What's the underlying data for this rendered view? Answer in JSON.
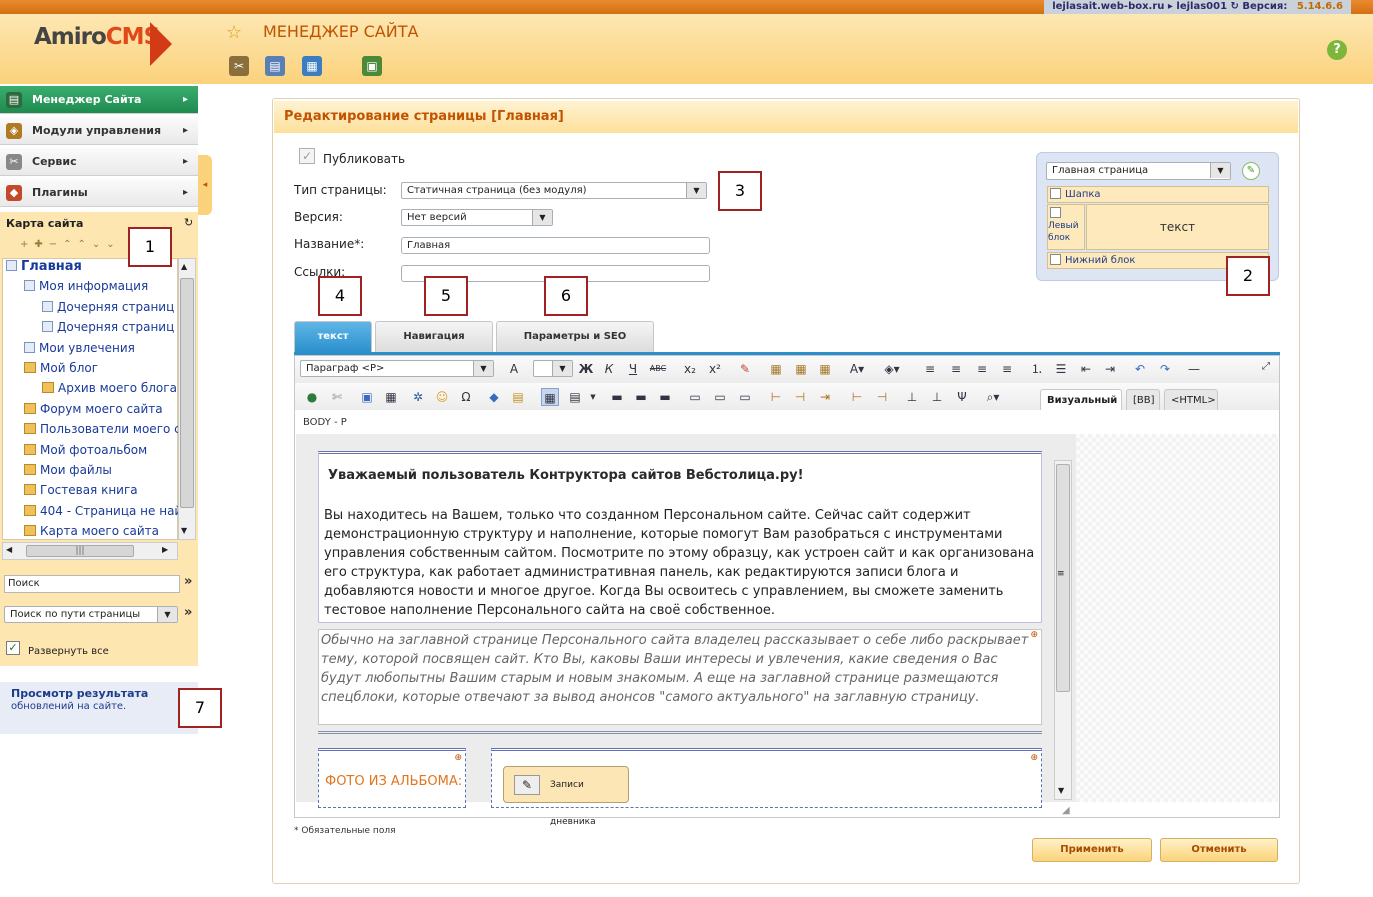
{
  "topbar": {
    "site": "lejlasait.web-box.ru",
    "sep": "▸",
    "user": "lejlas001",
    "version_label": "Версия:",
    "version": "5.14.6.6"
  },
  "header": {
    "logo_main": "Amiro",
    "logo_accent": "CMS",
    "title": "МЕНЕДЖЕР САЙТА",
    "help": "?"
  },
  "menu": [
    {
      "label": "Менеджер Сайта",
      "icon": "site-manager-icon",
      "active": true
    },
    {
      "label": "Модули управления",
      "icon": "modules-icon",
      "active": false
    },
    {
      "label": "Сервис",
      "icon": "service-icon",
      "active": false
    },
    {
      "label": "Плагины",
      "icon": "plugins-icon",
      "active": false
    }
  ],
  "sitemap": {
    "title": "Карта сайта",
    "tree": [
      {
        "label": "Главная",
        "level": 0,
        "type": "page",
        "bold": true
      },
      {
        "label": "Моя информация",
        "level": 1,
        "type": "page"
      },
      {
        "label": "Дочерняя страниц",
        "level": 2,
        "type": "page"
      },
      {
        "label": "Дочерняя страниц",
        "level": 2,
        "type": "page"
      },
      {
        "label": "Мои увлечения",
        "level": 1,
        "type": "page"
      },
      {
        "label": "Мой блог",
        "level": 1,
        "type": "module"
      },
      {
        "label": "Архив моего блога",
        "level": 2,
        "type": "module"
      },
      {
        "label": "Форум моего сайта",
        "level": 1,
        "type": "module"
      },
      {
        "label": "Пользователи моего с",
        "level": 1,
        "type": "module"
      },
      {
        "label": "Мой фотоальбом",
        "level": 1,
        "type": "module"
      },
      {
        "label": "Мои файлы",
        "level": 1,
        "type": "module"
      },
      {
        "label": "Гостевая книга",
        "level": 1,
        "type": "module"
      },
      {
        "label": "404 - Страница не най",
        "level": 1,
        "type": "module"
      },
      {
        "label": "Карта моего сайта",
        "level": 1,
        "type": "module"
      }
    ],
    "search_value": "Поиск",
    "search_by": "Поиск по пути страницы",
    "go": "»",
    "expand_all": "Развернуть все"
  },
  "preview": {
    "title": "Просмотр результата",
    "subtitle": "обновлений на сайте."
  },
  "panel": {
    "title": "Редактирование страницы [Главная]",
    "publish": "Публиковать",
    "page_type_label": "Тип страницы:",
    "page_type_value": "Статичная страница (без модуля)",
    "version_label": "Версия:",
    "version_value": "Нет версий",
    "name_label": "Название*:",
    "name_value": "Главная",
    "links_label": "Ссылки:",
    "links_value": ""
  },
  "layout": {
    "template": "Главная страница",
    "blocks": {
      "header": "Шапка",
      "left": "Левый блок",
      "center": "текст",
      "bottom": "Нижний блок"
    }
  },
  "tabs": [
    {
      "label": "текст",
      "active": true
    },
    {
      "label": "Навигация",
      "active": false
    },
    {
      "label": "Параметры и SEO",
      "active": false
    }
  ],
  "editor": {
    "format": "Параграф <P>",
    "modes": {
      "visual": "Визуальный",
      "bb": "[BB]",
      "html": "<HTML>"
    },
    "path": "BODY - P",
    "heading": "Уважаемый пользователь Контруктора сайтов Вебстолица.ру!",
    "intro": "Вы находитесь на Вашем, только что созданном Персональном сайте. Сейчас сайт содержит демонстрационную структуру и наполнение, которые помогут Вам разобраться с инструментами управления собственным сайтом. Посмотрите по этому образцу, как устроен сайт и как организована его структура, как работает административная панель, как редактируются записи блога и добавляются новости и многое другое. Когда Вы освоитесь с управлением, вы сможете заменить тестовое наполнение Персонального сайта на своё собственное.",
    "note": "Обычно на заглавной странице Персонального сайта владелец рассказывает о себе либо раскрывает тему, которой посвящен сайт. Кто Вы, каковы Ваши интересы и увлечения, какие сведения о Вас будут любопытны Вашим старым и новым знакомым. А еще на заглавной странице размещаются спецблоки, которые отвечают за вывод анонсов \"самого актуального\" на заглавную страницу.",
    "photo_block": "ФОТО ИЗ АЛЬБОМА:",
    "diary_block": "Записи дневника"
  },
  "required_note": "* Обязательные поля",
  "buttons": {
    "apply": "Применить",
    "cancel": "Отменить"
  },
  "callouts": [
    "1",
    "2",
    "3",
    "4",
    "5",
    "6",
    "7"
  ],
  "colors": {
    "accent": "#c25300",
    "topbar": "#d46e12",
    "active_menu": "#1e8a4e",
    "tab_active": "#2a8fcc"
  }
}
